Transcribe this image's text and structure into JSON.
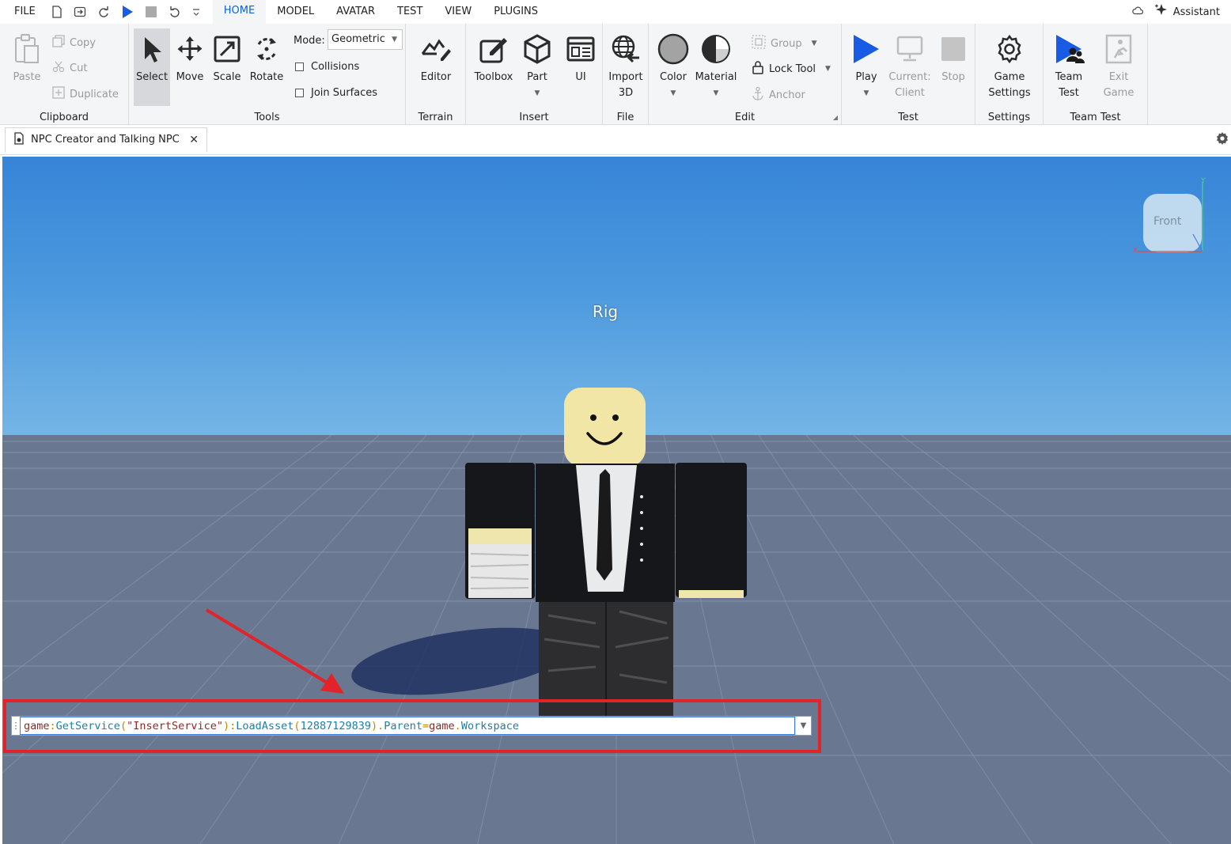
{
  "menubar": {
    "file_label": "FILE",
    "tabs": [
      {
        "label": "HOME",
        "active": true
      },
      {
        "label": "MODEL"
      },
      {
        "label": "AVATAR"
      },
      {
        "label": "TEST"
      },
      {
        "label": "VIEW"
      },
      {
        "label": "PLUGINS"
      }
    ],
    "assistant_label": "Assistant"
  },
  "ribbon": {
    "clipboard": {
      "paste": "Paste",
      "copy": "Copy",
      "cut": "Cut",
      "duplicate": "Duplicate",
      "label": "Clipboard"
    },
    "tools": {
      "select": "Select",
      "move": "Move",
      "scale": "Scale",
      "rotate": "Rotate",
      "mode_label": "Mode:",
      "mode_value": "Geometric",
      "collisions": "Collisions",
      "join_surfaces": "Join Surfaces",
      "label": "Tools"
    },
    "terrain": {
      "editor": "Editor",
      "label": "Terrain"
    },
    "insert": {
      "toolbox": "Toolbox",
      "part": "Part",
      "ui": "UI",
      "label": "Insert"
    },
    "file": {
      "import3d_line1": "Import",
      "import3d_line2": "3D",
      "label": "File"
    },
    "edit": {
      "color": "Color",
      "material": "Material",
      "group": "Group",
      "lock_tool": "Lock Tool",
      "anchor": "Anchor",
      "label": "Edit"
    },
    "test": {
      "play": "Play",
      "current_line1": "Current:",
      "current_line2": "Client",
      "stop": "Stop",
      "label": "Test"
    },
    "settings": {
      "game_line1": "Game",
      "game_line2": "Settings",
      "label": "Settings"
    },
    "team_test": {
      "team_line1": "Team",
      "team_line2": "Test",
      "exit_line1": "Exit",
      "exit_line2": "Game",
      "label": "Team Test"
    }
  },
  "document": {
    "tab_title": "NPC Creator and Talking NPC"
  },
  "viewport": {
    "rig_label": "Rig",
    "view_cube_face": "Front",
    "axis_x": "X",
    "axis_y": "Y"
  },
  "command_bar": {
    "tokens": [
      {
        "text": "game",
        "cls": "tk-kw"
      },
      {
        "text": ":",
        "cls": "tk-pu"
      },
      {
        "text": "GetService",
        "cls": "tk-fn"
      },
      {
        "text": "(",
        "cls": "tk-pu"
      },
      {
        "text": "\"InsertService\"",
        "cls": "tk-str"
      },
      {
        "text": "):",
        "cls": "tk-pu"
      },
      {
        "text": "LoadAsset",
        "cls": "tk-fn"
      },
      {
        "text": "(",
        "cls": "tk-pu"
      },
      {
        "text": "12887129839",
        "cls": "tk-num"
      },
      {
        "text": ").",
        "cls": "tk-pu"
      },
      {
        "text": "Parent",
        "cls": "tk-fn"
      },
      {
        "text": "=",
        "cls": "tk-pu"
      },
      {
        "text": "game",
        "cls": "tk-kw"
      },
      {
        "text": ".",
        "cls": "tk-pu"
      },
      {
        "text": "Workspace",
        "cls": "tk-fn"
      }
    ]
  },
  "colors": {
    "accent": "#0b63d6",
    "highlight": "#e2232a",
    "play": "#1a5be6"
  }
}
